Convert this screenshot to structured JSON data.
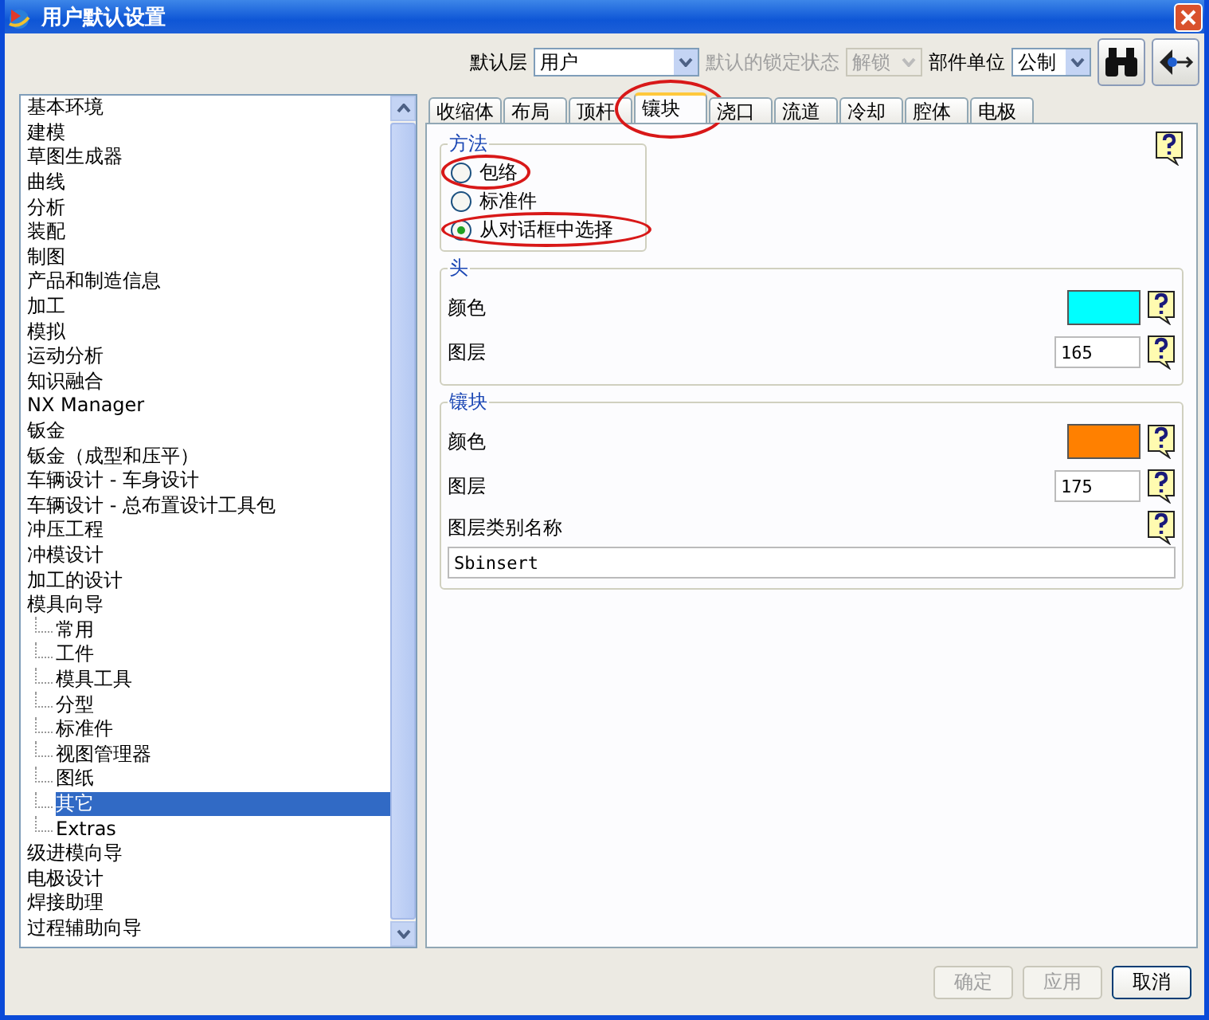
{
  "window": {
    "title": "用户默认设置"
  },
  "toolbar": {
    "default_layer": {
      "label": "默认层",
      "value": "用户"
    },
    "lock_state": {
      "label": "默认的锁定状态",
      "value": "解锁",
      "disabled": true
    },
    "part_units": {
      "label": "部件单位",
      "value": "公制"
    }
  },
  "sidebar": {
    "items": [
      {
        "label": "基本环境",
        "selected": false
      },
      {
        "label": "建模",
        "selected": false
      },
      {
        "label": "草图生成器",
        "selected": false
      },
      {
        "label": "曲线",
        "selected": false
      },
      {
        "label": "分析",
        "selected": false
      },
      {
        "label": "装配",
        "selected": false
      },
      {
        "label": "制图",
        "selected": false
      },
      {
        "label": "产品和制造信息",
        "selected": false
      },
      {
        "label": "加工",
        "selected": false
      },
      {
        "label": "模拟",
        "selected": false
      },
      {
        "label": "运动分析",
        "selected": false
      },
      {
        "label": "知识融合",
        "selected": false
      },
      {
        "label": "NX Manager",
        "selected": false
      },
      {
        "label": "钣金",
        "selected": false
      },
      {
        "label": "钣金（成型和压平）",
        "selected": false
      },
      {
        "label": "车辆设计 - 车身设计",
        "selected": false
      },
      {
        "label": "车辆设计 - 总布置设计工具包",
        "selected": false
      },
      {
        "label": "冲压工程",
        "selected": false
      },
      {
        "label": "冲模设计",
        "selected": false
      },
      {
        "label": "加工的设计",
        "selected": false
      },
      {
        "label": "模具向导",
        "selected": false,
        "children": [
          {
            "label": "常用",
            "selected": false
          },
          {
            "label": "工件",
            "selected": false
          },
          {
            "label": "模具工具",
            "selected": false
          },
          {
            "label": "分型",
            "selected": false
          },
          {
            "label": "标准件",
            "selected": false
          },
          {
            "label": "视图管理器",
            "selected": false
          },
          {
            "label": "图纸",
            "selected": false
          },
          {
            "label": "其它",
            "selected": true
          },
          {
            "label": "Extras",
            "selected": false
          }
        ]
      },
      {
        "label": "级进模向导",
        "selected": false
      },
      {
        "label": "电极设计",
        "selected": false
      },
      {
        "label": "焊接助理",
        "selected": false
      },
      {
        "label": "过程辅助向导",
        "selected": false
      }
    ]
  },
  "tabs": [
    {
      "label": "收缩体",
      "selected": false,
      "circled": false
    },
    {
      "label": "布局",
      "selected": false,
      "circled": false
    },
    {
      "label": "顶杆",
      "selected": false,
      "circled": false
    },
    {
      "label": "镶块",
      "selected": true,
      "circled": true
    },
    {
      "label": "浇口",
      "selected": false,
      "circled": false
    },
    {
      "label": "流道",
      "selected": false,
      "circled": false
    },
    {
      "label": "冷却",
      "selected": false,
      "circled": false
    },
    {
      "label": "腔体",
      "selected": false,
      "circled": false
    },
    {
      "label": "电极",
      "selected": false,
      "circled": false
    }
  ],
  "method_group": {
    "title": "方法",
    "options": [
      {
        "label": "包络",
        "selected": false,
        "circled": true
      },
      {
        "label": "标准件",
        "selected": false,
        "circled": false
      },
      {
        "label": "从对话框中选择",
        "selected": true,
        "circled": true
      }
    ]
  },
  "head_group": {
    "title": "头",
    "color_label": "颜色",
    "color": "#00ffff",
    "layer_label": "图层",
    "layer_value": "165"
  },
  "insert_group": {
    "title": "镶块",
    "color_label": "颜色",
    "color": "#ff8000",
    "layer_label": "图层",
    "layer_value": "175",
    "category_label": "图层类别名称",
    "category_value": "Sbinsert"
  },
  "buttons": [
    {
      "label": "确定",
      "disabled": true
    },
    {
      "label": "应用",
      "disabled": true
    },
    {
      "label": "取消",
      "disabled": false
    }
  ]
}
